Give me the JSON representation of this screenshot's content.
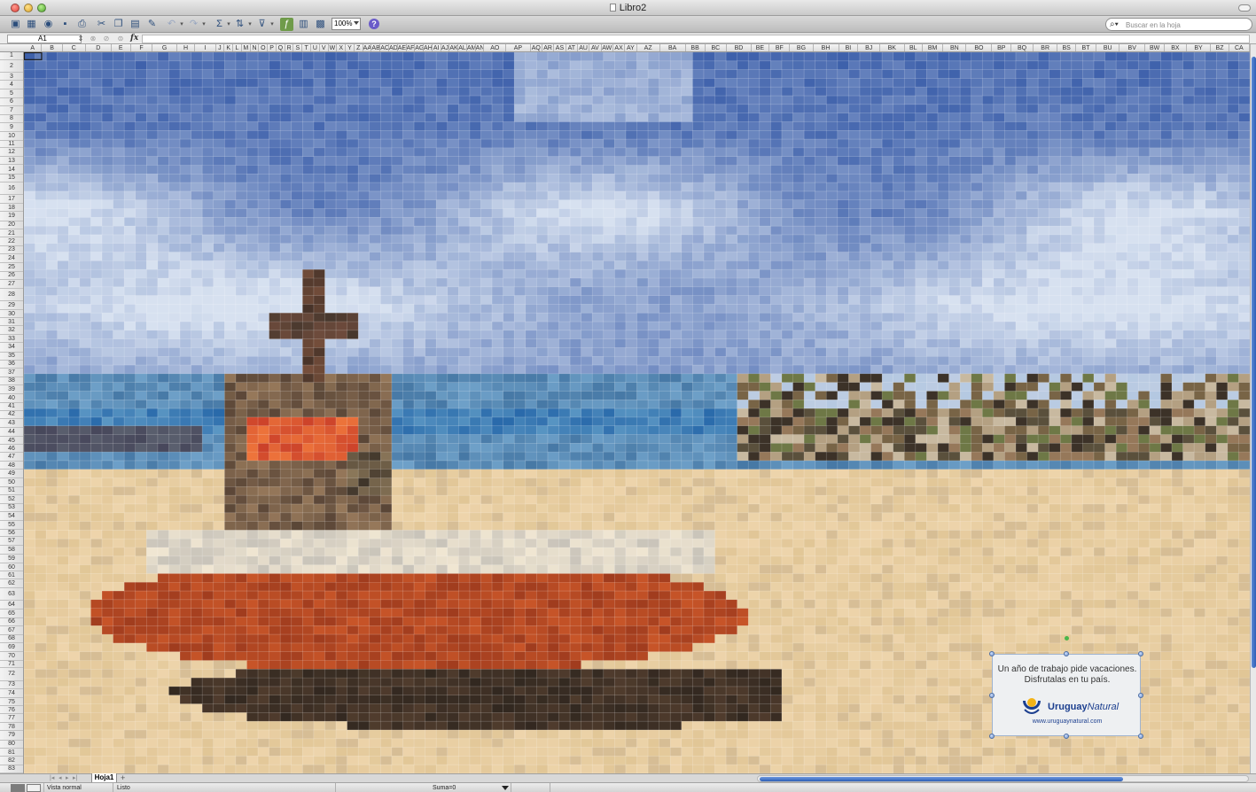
{
  "window": {
    "title": "Libro2"
  },
  "toolbar": {
    "zoom_value": "100%",
    "search_placeholder": "Buscar en la hoja",
    "icons": [
      "new-workbook-icon",
      "templates-icon",
      "open-icon",
      "save-icon",
      "print-icon",
      "cut-icon",
      "copy-icon",
      "paste-icon",
      "format-painter-icon",
      "undo-icon",
      "redo-icon",
      "autosum-icon",
      "sort-icon",
      "filter-icon",
      "gallery-icon",
      "toolbox-icon",
      "media-icon",
      "help-icon"
    ]
  },
  "formula_bar": {
    "cell_reference": "A1",
    "fx_label": "fx",
    "formula_value": ""
  },
  "grid": {
    "columns": [
      "A",
      "B",
      "C",
      "D",
      "E",
      "F",
      "G",
      "H",
      "I",
      "J",
      "K",
      "L",
      "M",
      "N",
      "O",
      "P",
      "Q",
      "R",
      "S",
      "T",
      "U",
      "V",
      "W",
      "X",
      "Y",
      "Z",
      "AA",
      "AB",
      "AC",
      "AD",
      "AE",
      "AF",
      "AG",
      "AH",
      "AI",
      "AJ",
      "AK",
      "AL",
      "AM",
      "AN",
      "AO",
      "AP",
      "AQ",
      "AR",
      "AS",
      "AT",
      "AU",
      "AV",
      "AW",
      "AX",
      "AY",
      "AZ",
      "BA",
      "BB",
      "BC",
      "BD",
      "BE",
      "BF",
      "BG",
      "BH",
      "BI",
      "BJ",
      "BK",
      "BL",
      "BM",
      "BN",
      "BO",
      "BP",
      "BQ",
      "BR",
      "BS",
      "BT",
      "BU",
      "BV",
      "BW",
      "BX",
      "BY",
      "BZ",
      "CA"
    ],
    "row_count": 83,
    "selected_cell": "A1"
  },
  "ad": {
    "line1": "Un año de trabajo pide vacaciones.",
    "line2": "Disfrutalas en tu país.",
    "brand_bold": "Uruguay",
    "brand_italic": "Natural",
    "url": "www.uruguaynatural.com",
    "colors": {
      "sun": "#f4b316",
      "arc": "#1c3f8f"
    }
  },
  "sheet_tabs": {
    "tabs": [
      "Hoja1"
    ],
    "add_label": "+"
  },
  "status_bar": {
    "view_label": "Vista normal",
    "status": "Listo",
    "sum": "Suma=0"
  },
  "colors": {
    "sky_deep": "#3f63a8",
    "sky_light": "#c9d7ea",
    "sea": "#3c7db5",
    "sand": "#e4c89a",
    "boat_red": "#c0542a",
    "accent_blue": "#2e5fb6"
  }
}
